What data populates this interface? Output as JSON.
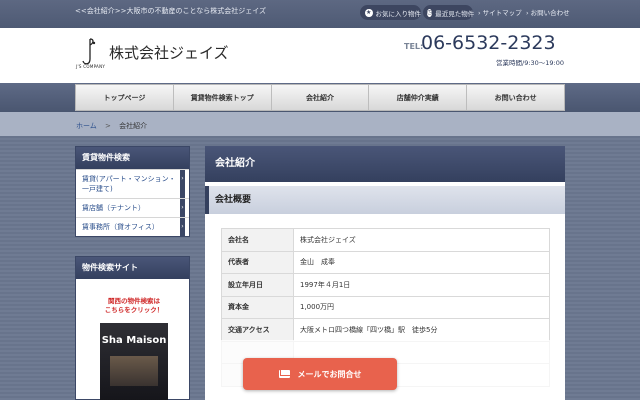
{
  "topbar": {
    "tagline": "<<会社紹介>>大阪市の不動産のことなら株式会社ジェイズ",
    "favorites": "お気に入り物件",
    "recent": "最近見た物件",
    "sitemap": "サイトマップ",
    "contact_link": "お問い合わせ"
  },
  "header": {
    "logo_sub": "J'S COMPANY",
    "company_name": "株式会社ジェイズ",
    "tel_label": "TEL:",
    "tel_number": "06-6532-2323",
    "hours": "営業時間/9:30～19:00"
  },
  "nav": [
    {
      "label": "トップページ"
    },
    {
      "label": "賃貸物件検索トップ"
    },
    {
      "label": "会社紹介"
    },
    {
      "label": "店舗仲介実績"
    },
    {
      "label": "お問い合わせ"
    }
  ],
  "breadcrumb": {
    "home": "ホーム",
    "sep": ">",
    "current": "会社紹介"
  },
  "sidebar": {
    "search_title": "賃貸物件検索",
    "items": [
      {
        "label": "賃貸(アパート・マンション・一戸建て)"
      },
      {
        "label": "賃店舗（テナント）"
      },
      {
        "label": "賃事務所（貸オフィス）"
      }
    ],
    "site_title": "物件検索サイト",
    "promo_line1": "関西の物件検索は",
    "promo_line2": "こちらをクリック！",
    "banner_text": "Sha Maison"
  },
  "content": {
    "title": "会社紹介",
    "section": "会社概要",
    "rows": [
      {
        "key": "会社名",
        "value": "株式会社ジェイズ"
      },
      {
        "key": "代表者",
        "value": "金山　成奉"
      },
      {
        "key": "設立年月日",
        "value": "1997年４月1日"
      },
      {
        "key": "資本金",
        "value": "1,000万円"
      },
      {
        "key": "交通アクセス",
        "value": "大阪メトロ四つ橋線「四ツ橋」駅　徒歩5分"
      }
    ]
  },
  "mail_button": "メールでお問合せ",
  "colors": {
    "navy": "#34405e",
    "accent_red": "#e8624d",
    "link_blue": "#2b4f8c"
  }
}
